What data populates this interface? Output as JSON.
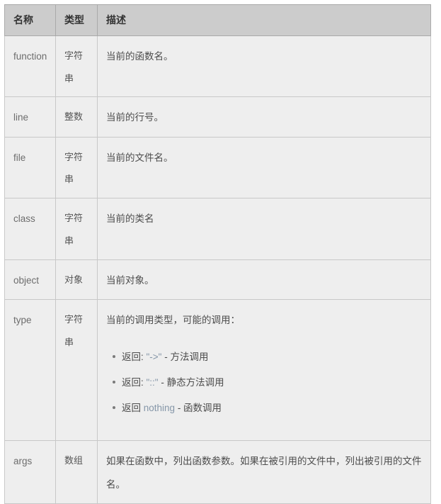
{
  "table": {
    "caption": "",
    "columns": [
      {
        "key": "name",
        "label": "名称"
      },
      {
        "key": "type",
        "label": "类型"
      },
      {
        "key": "desc",
        "label": "描述"
      }
    ],
    "rows": [
      {
        "id": "function",
        "name": "function",
        "type": "字符串",
        "desc": "当前的函数名。"
      },
      {
        "id": "line",
        "name": "line",
        "type": "整数",
        "desc": "当前的行号。"
      },
      {
        "id": "file",
        "name": "file",
        "type": "字符串",
        "desc": "当前的文件名。"
      },
      {
        "id": "class",
        "name": "class",
        "type": "字符串",
        "desc": "当前的类名"
      },
      {
        "id": "object",
        "name": "object",
        "type": "对象",
        "desc": "当前对象。"
      },
      {
        "id": "type",
        "name": "type",
        "type": "字符串",
        "desc": "当前的调用类型，可能的调用：",
        "bullets": [
          {
            "prefix": "返回: ",
            "code": "\"->\"",
            "suffix": " - 方法调用"
          },
          {
            "prefix": "返回: ",
            "code": "\"::\"",
            "suffix": " - 静态方法调用"
          },
          {
            "prefix": "返回 ",
            "code": "nothing",
            "suffix": " - 函数调用"
          }
        ]
      },
      {
        "id": "args",
        "name": "args",
        "type": "数组",
        "desc": "如果在函数中，列出函数参数。如果在被引用的文件中，列出被引用的文件名。"
      }
    ]
  },
  "colors": {
    "header_background": "#cccccc",
    "header_text": "#333333",
    "cell_background": "#eeeeee",
    "cell_text": "#4d4d4d",
    "name_text": "#6d6d6d",
    "code_text": "#8596a8",
    "outer_border": "#aaaaaa",
    "inner_border": "#c8c8c8",
    "page_background": "#ffffff",
    "bullet": "#7a7a7a"
  }
}
